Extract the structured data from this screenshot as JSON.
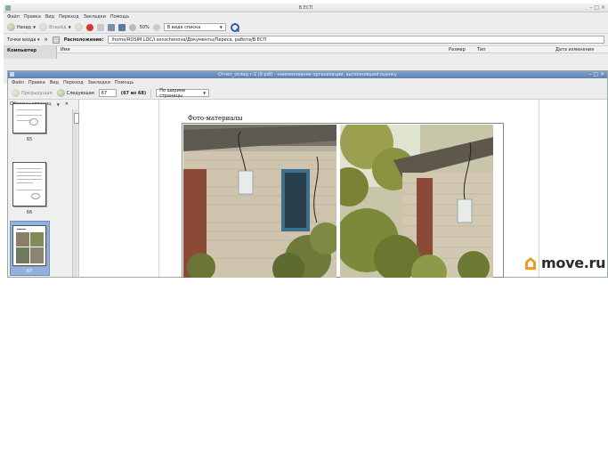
{
  "file_manager": {
    "title": "В ЕСП",
    "menu": [
      "Файл",
      "Правка",
      "Вид",
      "Переход",
      "Закладки",
      "Помощь"
    ],
    "toolbar": {
      "back": "Назад",
      "forward": "Вперёд",
      "zoom": "50%",
      "view_mode": "В виде списка"
    },
    "location_bar": {
      "mode": "Точки входа",
      "label": "Расположение:",
      "path": "/home/ROSIM.LOC/i.sonschenova/Документы/Переса. работа/В ЕСП"
    },
    "sidebar_header": "Компьютер",
    "columns": {
      "name": "Имя",
      "size": "Размер",
      "type": "Тип",
      "modified": "Дата изменения"
    }
  },
  "doc_viewer": {
    "title": "Отчет_склад г-1 (9 pdf) - наименование организации, выполнившей оценку",
    "menu": [
      "Файл",
      "Правка",
      "Вид",
      "Переход",
      "Закладки",
      "Помощь"
    ],
    "toolbar": {
      "prev": "Предыдущая",
      "next": "Следующая",
      "page_value": "67",
      "page_count": "(67 из 68)",
      "zoom_mode": "По ширине страницы"
    },
    "sidebar": {
      "title": "Образцы страниц",
      "thumbnails": [
        {
          "label": "65"
        },
        {
          "label": "66"
        },
        {
          "label": "67"
        }
      ]
    },
    "page": {
      "heading": "Фото-материалы"
    }
  },
  "watermark": {
    "brand": "move.ru",
    "icon_color": "#f29a1e"
  }
}
